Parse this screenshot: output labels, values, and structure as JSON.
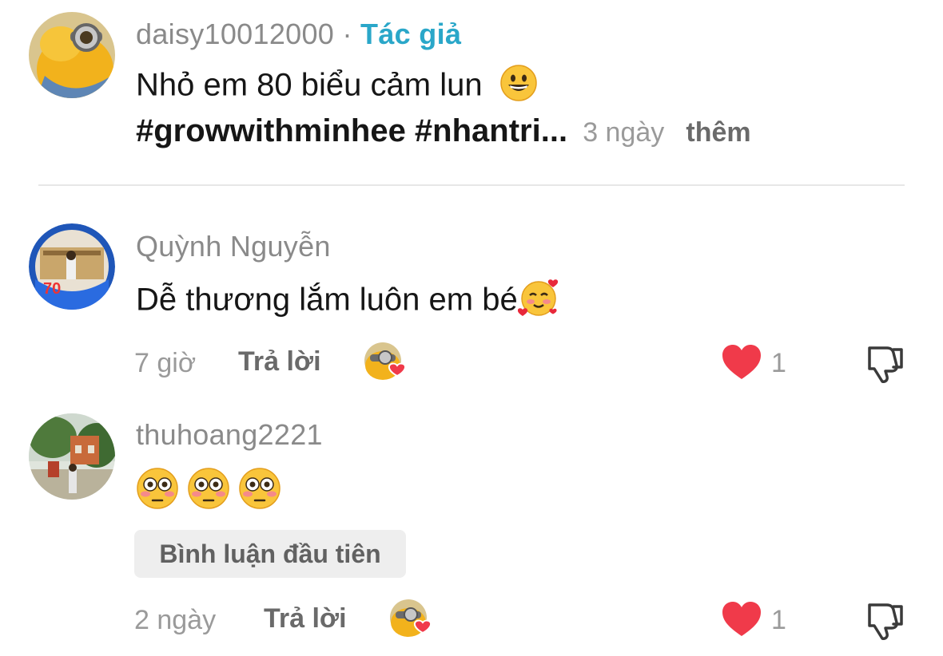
{
  "caption": {
    "username": "daisy10012000",
    "separator": "·",
    "author_label": "Tác giả",
    "text_line1": "Nhỏ em 80 biểu cảm lun",
    "text_line1_emoji": "grinning-face",
    "hashtags": "#growwithminhee #nhantri...",
    "time": "3 ngày",
    "more": "thêm"
  },
  "comments": [
    {
      "username": "Quỳnh Nguyễn",
      "text": "Dễ thương lắm luôn em bé",
      "emoji": "smiling-face-with-hearts",
      "time": "7 giờ",
      "reply_label": "Trả lời",
      "like_count": "1",
      "liked": true
    },
    {
      "username": "thuhoang2221",
      "emoji_row": [
        "flushed-face",
        "flushed-face",
        "flushed-face"
      ],
      "badge": "Bình luận đầu tiên",
      "time": "2 ngày",
      "reply_label": "Trả lời",
      "like_count": "1",
      "liked": true
    }
  ],
  "colors": {
    "author_tag": "#2aa7c9",
    "like_red": "#f03a4a",
    "meta_grey": "#9a9a9a"
  }
}
